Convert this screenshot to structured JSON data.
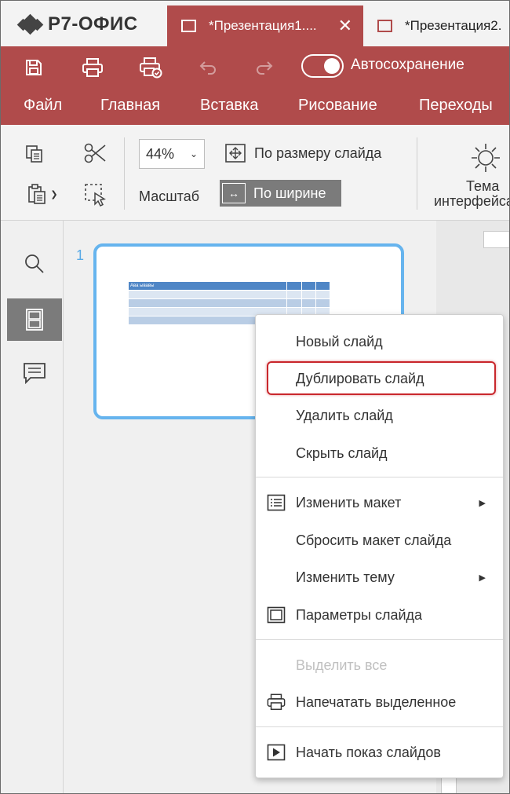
{
  "app": {
    "logo_text": "Р7-ОФИС"
  },
  "tabs": [
    {
      "title": "*Презентация1....",
      "active": true
    },
    {
      "title": "*Презентация2.",
      "active": false
    }
  ],
  "quick_access": {
    "autosave_label": "Автосохранение",
    "autosave_on": true
  },
  "menu": [
    "Файл",
    "Главная",
    "Вставка",
    "Рисование",
    "Переходы"
  ],
  "toolbar": {
    "zoom_value": "44%",
    "zoom_label": "Масштаб",
    "fit_slide": "По размеру слайда",
    "fit_width": "По ширине",
    "theme_label_1": "Тема",
    "theme_label_2": "интерфейса"
  },
  "slides": {
    "number": "1",
    "table_header": "Ава ывавы"
  },
  "context_menu": {
    "items": [
      {
        "label": "Новый слайд"
      },
      {
        "label": "Дублировать слайд",
        "highlighted": true
      },
      {
        "label": "Удалить слайд"
      },
      {
        "label": "Скрыть слайд"
      },
      {
        "label": "Изменить макет",
        "icon": "layout-icon",
        "submenu": true
      },
      {
        "label": "Сбросить макет слайда"
      },
      {
        "label": "Изменить тему",
        "submenu": true
      },
      {
        "label": "Параметры слайда",
        "icon": "slide-settings-icon"
      },
      {
        "label": "Выделить все",
        "disabled": true
      },
      {
        "label": "Напечатать выделенное",
        "icon": "printer-icon"
      },
      {
        "label": "Начать показ слайдов",
        "icon": "play-icon"
      }
    ]
  },
  "colors": {
    "brand": "#b04b4b",
    "accent": "#66b4ee",
    "highlight": "#c9272c"
  }
}
